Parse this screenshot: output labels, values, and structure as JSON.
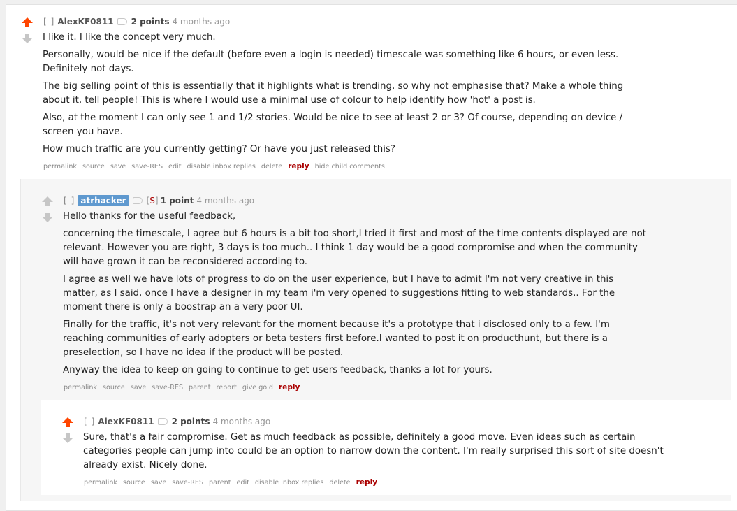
{
  "colors": {
    "upvote_active": "#ff4500",
    "vote_inactive": "#c6c6c6",
    "op_badge": "#5f99cf",
    "reply": "#aa0000"
  },
  "comments": [
    {
      "toggle": "[–]",
      "author": "AlexKF0811",
      "score": "2 points",
      "time": "4 months ago",
      "paragraphs": [
        "I like it. I like the concept very much.",
        "Personally, would be nice if the default (before even a login is needed) timescale was something like 6 hours, or even less. Definitely not days.",
        "The big selling point of this is essentially that it highlights what is trending, so why not emphasise that? Make a whole thing about it, tell people! This is where I would use a minimal use of colour to help identify how 'hot' a post is.",
        "Also, at the moment I can only see 1 and 1/2 stories. Would be nice to see at least 2 or 3? Of course, depending on device / screen you have.",
        "How much traffic are you currently getting? Or have you just released this?"
      ],
      "buttons": [
        "permalink",
        "source",
        "save",
        "save-RES",
        "edit",
        "disable inbox replies",
        "delete",
        "reply",
        "hide child comments"
      ]
    },
    {
      "toggle": "[–]",
      "author": "atrhacker",
      "submitter_badge": "S",
      "score": "1 point",
      "time": "4 months ago",
      "paragraphs": [
        "Hello thanks for the useful feedback,",
        "concerning the timescale, I agree but 6 hours is a bit too short,I tried it first and most of the time contents displayed are not relevant. However you are right, 3 days is too much.. I think 1 day would be a good compromise and when the community will have grown it can be reconsidered according to.",
        "I agree as well we have lots of progress to do on the user experience, but I have to admit I'm not very creative in this matter, as I said, once I have a designer in my team i'm very opened to suggestions fitting to web standards.. For the moment there is only a boostrap an a very poor UI.",
        "Finally for the traffic, it's not very relevant for the moment because it's a prototype that i disclosed only to a few. I'm reaching communities of early adopters or beta testers first before.I wanted to post it on producthunt, but there is a preselection, so I have no idea if the product will be posted.",
        "Anyway the idea to keep on going to continue to get users feedback, thanks a lot for yours."
      ],
      "buttons": [
        "permalink",
        "source",
        "save",
        "save-RES",
        "parent",
        "report",
        "give gold",
        "reply"
      ]
    },
    {
      "toggle": "[–]",
      "author": "AlexKF0811",
      "score": "2 points",
      "time": "4 months ago",
      "paragraphs": [
        "Sure, that's a fair compromise. Get as much feedback as possible, definitely a good move. Even ideas such as certain categories people can jump into could be an option to narrow down the content. I'm really surprised this sort of site doesn't already exist. Nicely done."
      ],
      "buttons": [
        "permalink",
        "source",
        "save",
        "save-RES",
        "parent",
        "edit",
        "disable inbox replies",
        "delete",
        "reply"
      ]
    }
  ]
}
